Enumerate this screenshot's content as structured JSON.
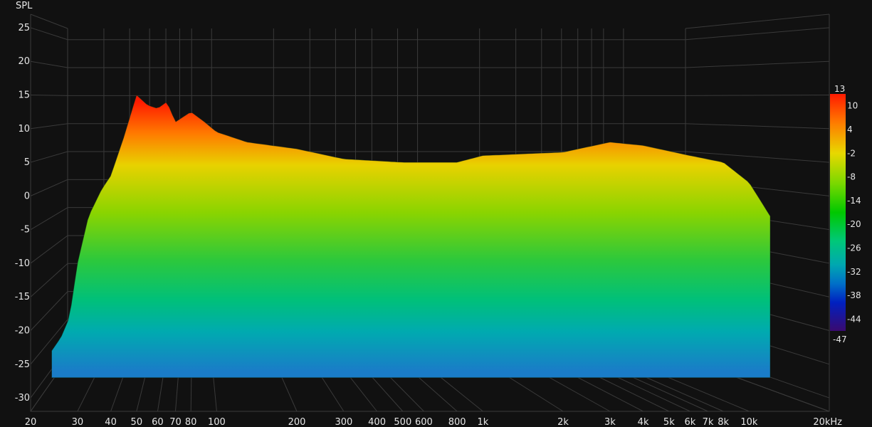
{
  "chart_data": {
    "type": "waterfall",
    "ylabel": "SPL",
    "ylim": [
      -32,
      27
    ],
    "y_ticks": [
      "25",
      "20",
      "15",
      "10",
      "5",
      "0",
      "-5",
      "-10",
      "-15",
      "-20",
      "-25",
      "-30"
    ],
    "x_scale": "log",
    "xlim_hz": [
      20,
      20000
    ],
    "x_ticks": [
      {
        "hz": 20,
        "label": "20"
      },
      {
        "hz": 30,
        "label": "30"
      },
      {
        "hz": 40,
        "label": "40"
      },
      {
        "hz": 50,
        "label": "50"
      },
      {
        "hz": 60,
        "label": "60"
      },
      {
        "hz": 70,
        "label": "70"
      },
      {
        "hz": 80,
        "label": "80"
      },
      {
        "hz": 100,
        "label": "100"
      },
      {
        "hz": 200,
        "label": "200"
      },
      {
        "hz": 300,
        "label": "300"
      },
      {
        "hz": 400,
        "label": "400"
      },
      {
        "hz": 500,
        "label": "500"
      },
      {
        "hz": 600,
        "label": "600"
      },
      {
        "hz": 800,
        "label": "800"
      },
      {
        "hz": 1000,
        "label": "1k"
      },
      {
        "hz": 2000,
        "label": "2k"
      },
      {
        "hz": 3000,
        "label": "3k"
      },
      {
        "hz": 4000,
        "label": "4k"
      },
      {
        "hz": 5000,
        "label": "5k"
      },
      {
        "hz": 6000,
        "label": "6k"
      },
      {
        "hz": 7000,
        "label": "7k"
      },
      {
        "hz": 8000,
        "label": "8k"
      },
      {
        "hz": 10000,
        "label": "10k"
      },
      {
        "hz": 20000,
        "label": "20kHz"
      }
    ],
    "colorbar": {
      "max_label": "13",
      "min_label": "-47",
      "ticks": [
        "10",
        "4",
        "-2",
        "-8",
        "-14",
        "-20",
        "-26",
        "-32",
        "-38",
        "-44"
      ]
    },
    "front_slice_db": [
      {
        "hz": 24,
        "db": -23
      },
      {
        "hz": 26,
        "db": -21
      },
      {
        "hz": 28,
        "db": -18
      },
      {
        "hz": 30,
        "db": -10
      },
      {
        "hz": 33,
        "db": -3
      },
      {
        "hz": 37,
        "db": 1
      },
      {
        "hz": 40,
        "db": 3
      },
      {
        "hz": 45,
        "db": 9
      },
      {
        "hz": 50,
        "db": 15
      },
      {
        "hz": 55,
        "db": 13.5
      },
      {
        "hz": 60,
        "db": 13
      },
      {
        "hz": 65,
        "db": 14
      },
      {
        "hz": 70,
        "db": 11
      },
      {
        "hz": 80,
        "db": 12.5
      },
      {
        "hz": 90,
        "db": 11
      },
      {
        "hz": 100,
        "db": 9.5
      },
      {
        "hz": 130,
        "db": 8
      },
      {
        "hz": 200,
        "db": 7
      },
      {
        "hz": 300,
        "db": 5.5
      },
      {
        "hz": 500,
        "db": 5
      },
      {
        "hz": 800,
        "db": 5
      },
      {
        "hz": 1000,
        "db": 6
      },
      {
        "hz": 2000,
        "db": 6.5
      },
      {
        "hz": 3000,
        "db": 8
      },
      {
        "hz": 4000,
        "db": 7.5
      },
      {
        "hz": 6000,
        "db": 6
      },
      {
        "hz": 8000,
        "db": 5
      },
      {
        "hz": 10000,
        "db": 2
      },
      {
        "hz": 12000,
        "db": -3
      }
    ]
  },
  "colors": {
    "background": "#111111",
    "grid": "#3a3a3a",
    "text": "#e6e6e6"
  }
}
